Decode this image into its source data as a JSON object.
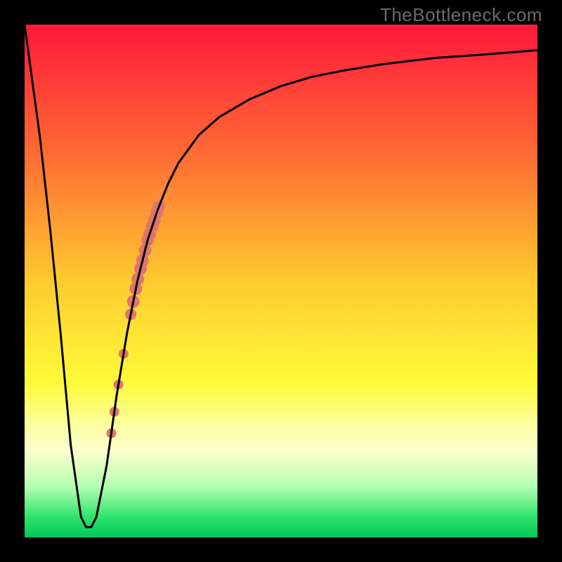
{
  "watermark": "TheBottleneck.com",
  "gradient": {
    "stops": [
      {
        "offset": 0.0,
        "color": "#ff183b"
      },
      {
        "offset": 0.25,
        "color": "#ff6a34"
      },
      {
        "offset": 0.5,
        "color": "#ffca2f"
      },
      {
        "offset": 0.7,
        "color": "#fffb39"
      },
      {
        "offset": 0.78,
        "color": "#fcffa0"
      },
      {
        "offset": 0.83,
        "color": "#fdffcc"
      },
      {
        "offset": 0.9,
        "color": "#b6ffb3"
      },
      {
        "offset": 0.96,
        "color": "#2fe36d"
      },
      {
        "offset": 1.0,
        "color": "#00c85a"
      }
    ]
  },
  "chart_data": {
    "type": "line",
    "title": "",
    "xlabel": "",
    "ylabel": "",
    "xlim": [
      0,
      100
    ],
    "ylim": [
      0,
      100
    ],
    "series": [
      {
        "name": "bottleneck-curve",
        "x": [
          0,
          3,
          5,
          7,
          9,
          11,
          12,
          13,
          14,
          16,
          18,
          20,
          22,
          24,
          26,
          28,
          30,
          34,
          38,
          44,
          50,
          56,
          62,
          70,
          80,
          90,
          100
        ],
        "y": [
          100,
          78,
          60,
          40,
          18,
          4,
          2,
          2,
          4,
          14,
          28,
          40,
          50,
          58,
          64,
          69,
          73,
          78.5,
          82,
          85.5,
          88,
          89.8,
          91,
          92.3,
          93.5,
          94.2,
          95
        ]
      }
    ],
    "markers": {
      "name": "highlight-points",
      "color": "#e0746e",
      "points": [
        {
          "x": 16.9,
          "r": 7
        },
        {
          "x": 17.5,
          "r": 7
        },
        {
          "x": 18.3,
          "r": 7
        },
        {
          "x": 19.3,
          "r": 7
        },
        {
          "x": 20.7,
          "r": 8
        },
        {
          "x": 21.2,
          "r": 9
        },
        {
          "x": 21.7,
          "r": 9
        },
        {
          "x": 22.1,
          "r": 9
        },
        {
          "x": 22.6,
          "r": 9
        },
        {
          "x": 23.0,
          "r": 9
        },
        {
          "x": 23.5,
          "r": 9
        },
        {
          "x": 24.0,
          "r": 9
        },
        {
          "x": 24.4,
          "r": 9
        },
        {
          "x": 24.9,
          "r": 9
        },
        {
          "x": 25.3,
          "r": 9
        },
        {
          "x": 25.8,
          "r": 9
        },
        {
          "x": 26.2,
          "r": 9
        }
      ]
    }
  }
}
